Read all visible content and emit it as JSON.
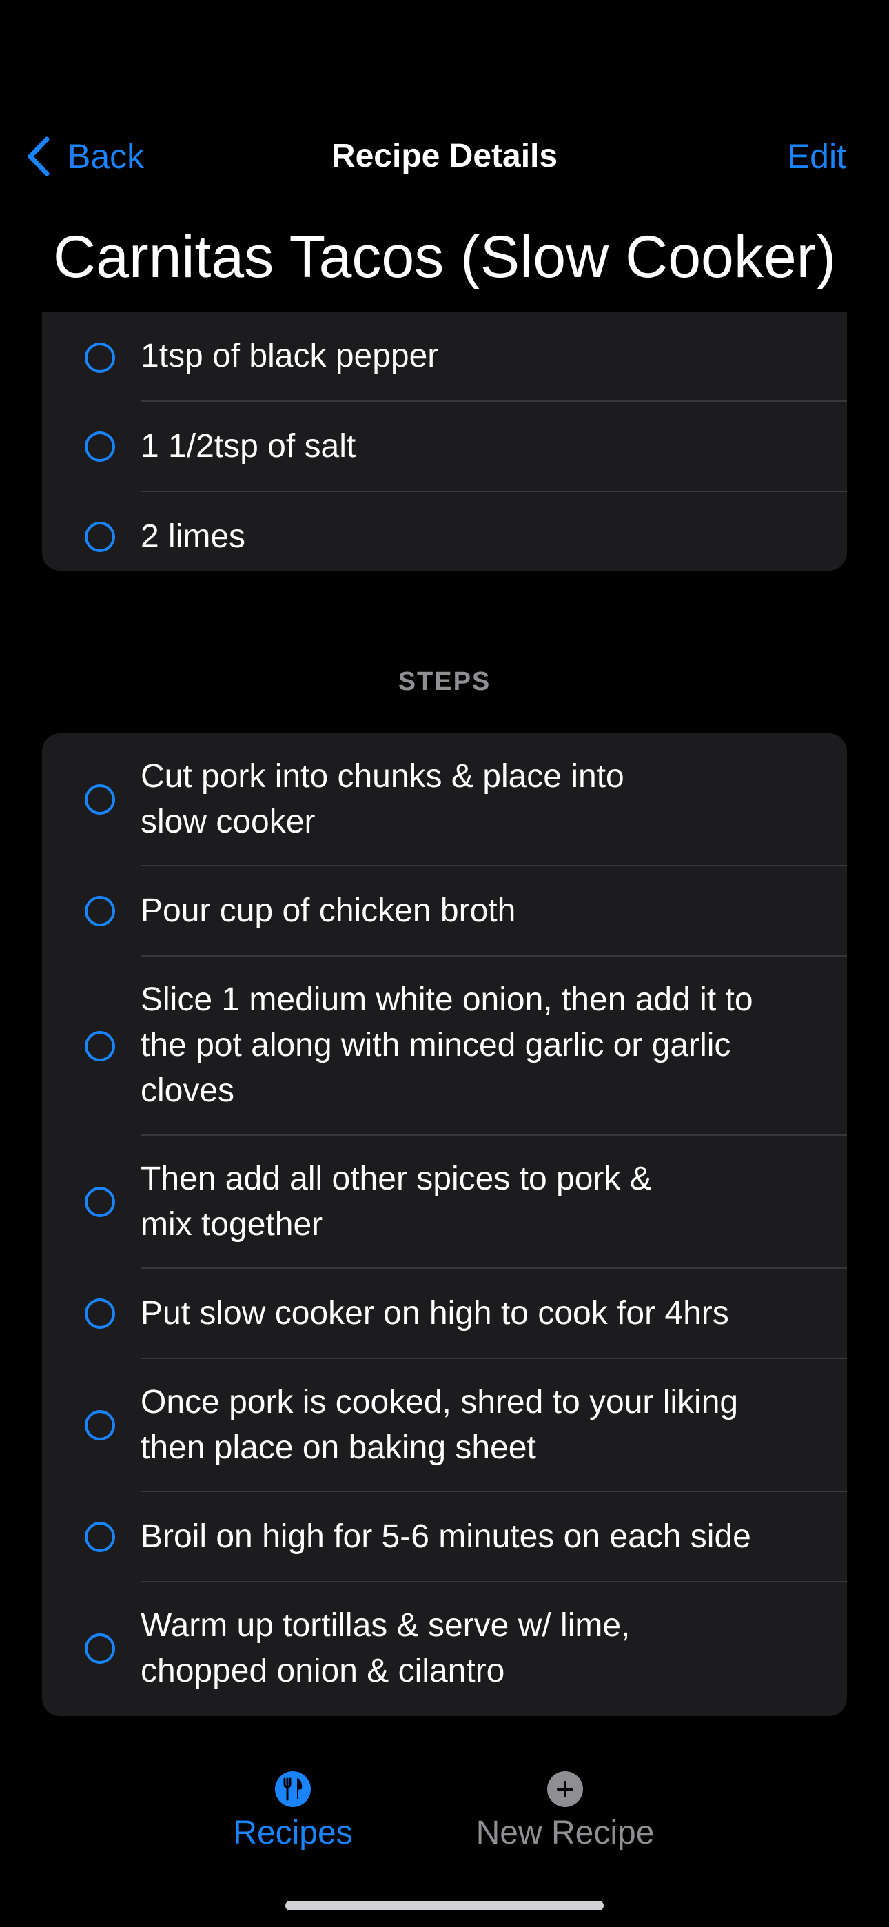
{
  "nav": {
    "back_label": "Back",
    "title": "Recipe Details",
    "edit_label": "Edit"
  },
  "recipe": {
    "title": "Carnitas Tacos (Slow Cooker)"
  },
  "ingredients": [
    "1tsp of black pepper",
    "1 1/2tsp of salt",
    "2 limes"
  ],
  "steps_header": "STEPS",
  "steps": [
    "Cut pork into chunks & place into\nslow cooker",
    "Pour cup of chicken broth",
    "Slice 1 medium white onion, then add it to\nthe pot along with minced garlic or garlic\ncloves",
    "Then add all other spices to pork &\nmix together",
    "Put slow cooker on high to cook for 4hrs",
    "Once pork is cooked, shred to your liking\nthen place on baking sheet",
    "Broil on high for 5-6 minutes on each side",
    "Warm up tortillas & serve w/ lime,\nchopped onion & cilantro"
  ],
  "tabs": [
    {
      "label": "Recipes",
      "icon": "fork-knife-icon",
      "selected": true
    },
    {
      "label": "New Recipe",
      "icon": "plus-circle-icon",
      "selected": false
    }
  ],
  "colors": {
    "accent": "#1a84ff",
    "background": "#000000",
    "card": "#1c1c1e",
    "secondary_text": "#8e8e93"
  }
}
